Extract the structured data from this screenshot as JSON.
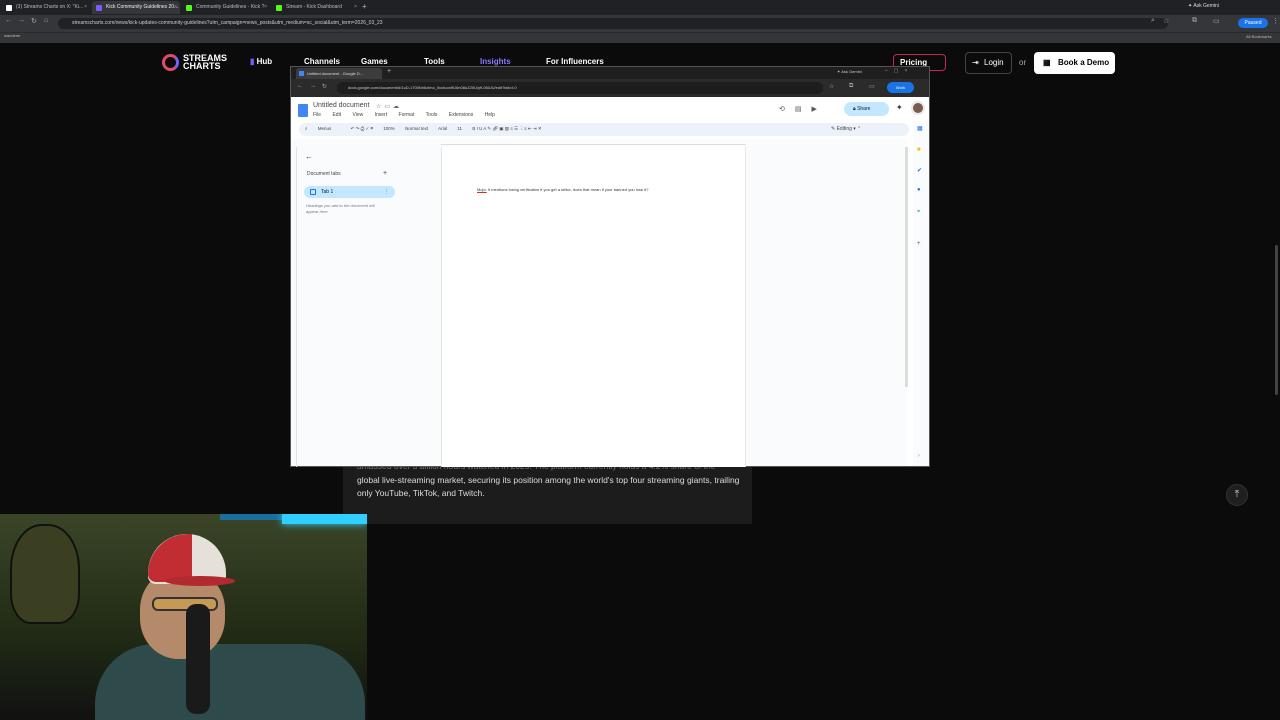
{
  "outer_browser": {
    "tabs": [
      {
        "title": "(3) Streams Charts on X: \"Ki..."
      },
      {
        "title": "Kick Community Guidelines 20...",
        "active": true
      },
      {
        "title": "Community Guidelines - Kick ?"
      },
      {
        "title": "Stream - Kick Dashboard"
      }
    ],
    "new_tab": "+",
    "ask_gemini": "Ask Gemini",
    "url": "streamscharts.com/news/kick-updates-community-guidelines?utm_campaign=news_posts&utm_medium=sc_social&utm_term=2026_03_23",
    "profile_status": "Paused",
    "bookmark": "wanderer",
    "all_bookmarks": "All Bookmarks"
  },
  "site": {
    "logo_line1": "STREAMS",
    "logo_line2": "CHARTS",
    "nav": [
      "Hub",
      "Channels",
      "Games",
      "Tools",
      "Insights",
      "For Influencers"
    ],
    "pricing": "Pricing",
    "login": "Login",
    "or": "or",
    "book_demo": "Book a Demo",
    "article_text_partial": "amassed over 3 billion hours watched in 2025. The platform currently holds a 4.2% share of the",
    "article_text": "global live-streaming market, securing its position among the world's top four streaming giants, trailing only YouTube, TikTok, and Twitch."
  },
  "inner_browser": {
    "tab_title": "Untitled document - Google D...",
    "new_tab": "+",
    "ask_gemini": "Ask Gemini",
    "url": "docs.google.com/document/d/1uD-1700Nh6zlmo_5vctuon9U6n08uZ20U/yfi-06lUU/edit?tab=t.0",
    "profile_status": "Work"
  },
  "docs": {
    "title": "Untitled document",
    "menu": [
      "File",
      "Edit",
      "View",
      "Insert",
      "Format",
      "Tools",
      "Extensions",
      "Help"
    ],
    "share": "Share",
    "toolbar": {
      "menus": "Menus",
      "zoom": "100%",
      "style": "Normal text",
      "font": "Arial",
      "size": "11"
    },
    "mode": "Editing",
    "outline_title": "Document tabs",
    "tab_name": "Tab 1",
    "outline_hint": "Headings you add to the document will appear here.",
    "body_first_word": "Mojo:",
    "body_text": " It mentions losing verification if you get a strike- does that mean if your banned you lose it?"
  }
}
